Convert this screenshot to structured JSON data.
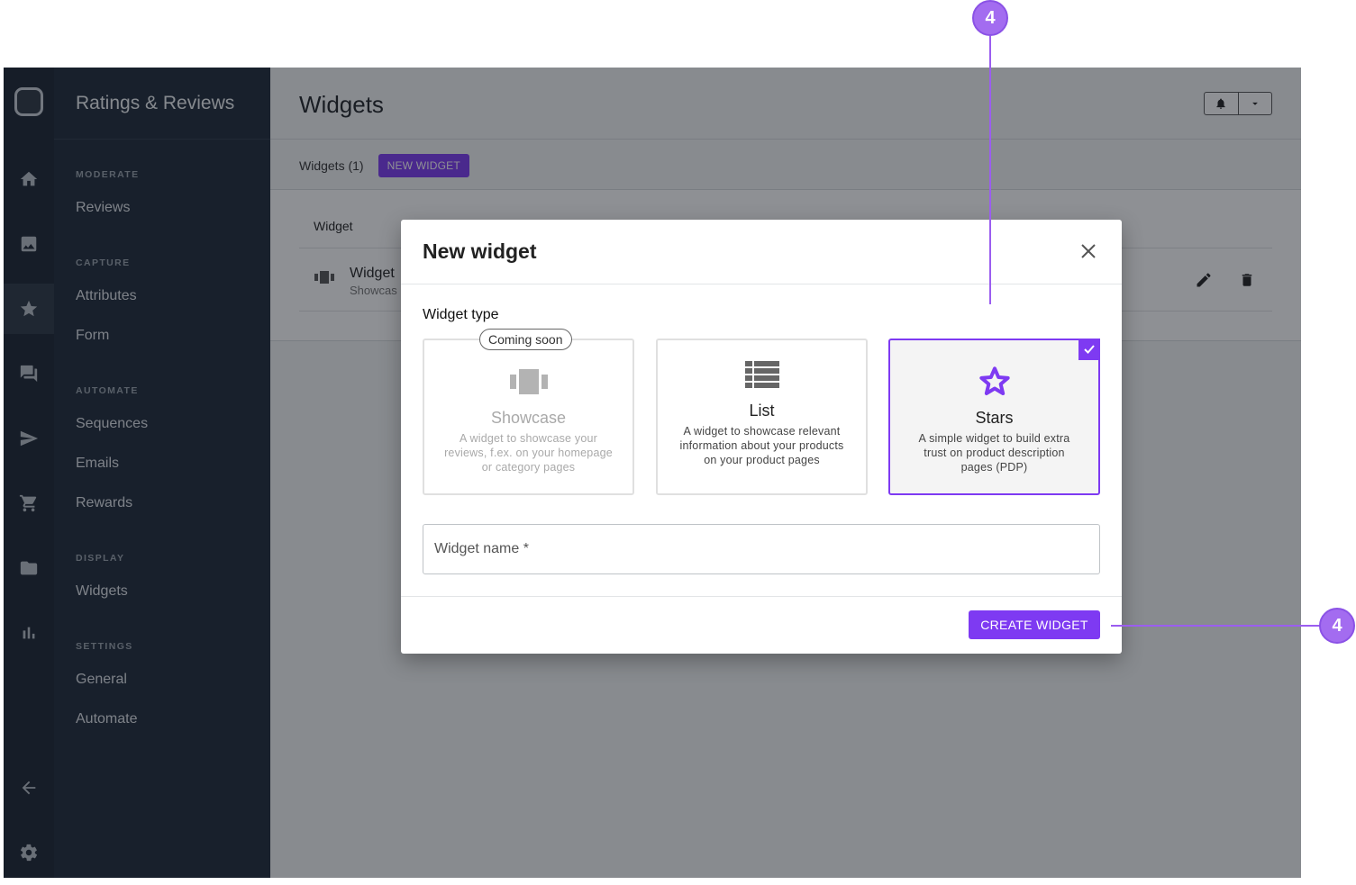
{
  "app": {
    "title": "Ratings & Reviews"
  },
  "rail": {
    "icons": [
      "logo-icon",
      "home-icon",
      "image-icon",
      "star-icon",
      "chat-icon",
      "send-icon",
      "cart-icon",
      "folder-icon",
      "bar-chart-icon",
      "arrow-left-icon",
      "gear-icon"
    ],
    "active": "star-icon"
  },
  "nav": {
    "sections": [
      {
        "title": "MODERATE",
        "items": [
          "Reviews"
        ]
      },
      {
        "title": "CAPTURE",
        "items": [
          "Attributes",
          "Form"
        ]
      },
      {
        "title": "AUTOMATE",
        "items": [
          "Sequences",
          "Emails",
          "Rewards"
        ]
      },
      {
        "title": "DISPLAY",
        "items": [
          "Widgets"
        ]
      },
      {
        "title": "SETTINGS",
        "items": [
          "General",
          "Automate"
        ]
      }
    ]
  },
  "page": {
    "title": "Widgets",
    "count_label": "Widgets (1)",
    "new_widget_button": "NEW WIDGET",
    "table": {
      "header": "Widget",
      "rows": [
        {
          "title": "Widget",
          "subtitle": "Showcas"
        }
      ]
    }
  },
  "modal": {
    "title": "New widget",
    "type_label": "Widget type",
    "cards": [
      {
        "title": "Showcase",
        "description": "A widget to showcase your reviews, f.ex. on your homepage or category pages",
        "badge": "Coming soon",
        "disabled": true
      },
      {
        "title": "List",
        "description": "A widget to showcase relevant information about your products on your product pages"
      },
      {
        "title": "Stars",
        "description": "A simple widget to build extra trust on product description pages (PDP)",
        "selected": true
      }
    ],
    "name_placeholder": "Widget name *",
    "name_value": "",
    "create_button": "CREATE WIDGET"
  },
  "callouts": [
    "4",
    "4"
  ],
  "colors": {
    "accent": "#7e3af2",
    "callout": "#a36cf0",
    "sidebar": "#1e2a38",
    "rail": "#1a2330"
  }
}
